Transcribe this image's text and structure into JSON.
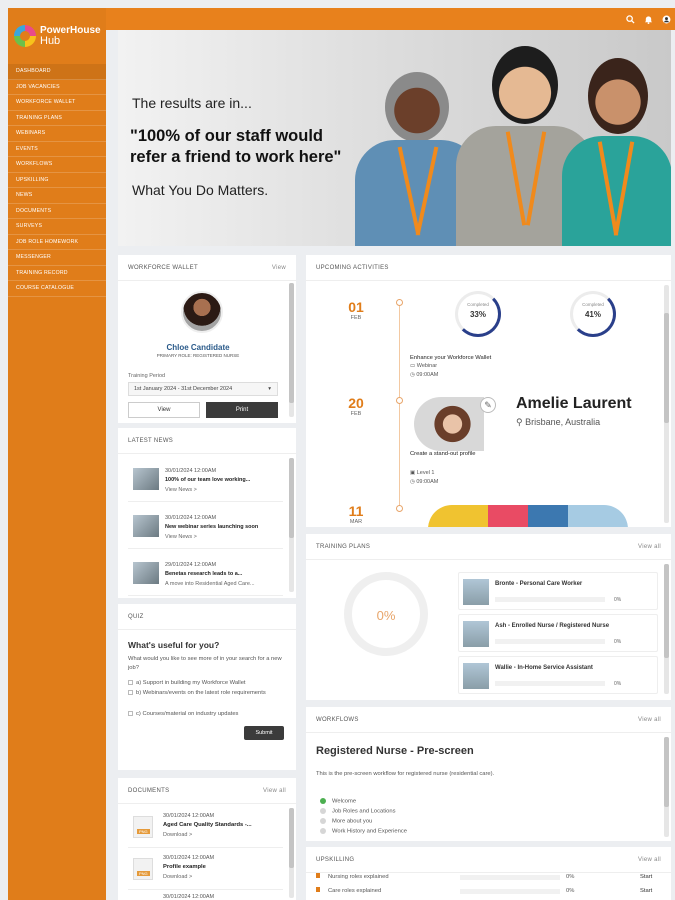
{
  "brand": {
    "name": "PowerHouse",
    "sub": "Hub"
  },
  "nav": [
    "Dashboard",
    "Job Vacancies",
    "Workforce Wallet",
    "Training Plans",
    "Webinars",
    "Events",
    "Workflows",
    "Upskilling",
    "News",
    "Documents",
    "Surveys",
    "Job Role Homework",
    "Messenger",
    "Training Record",
    "Course Catalogue"
  ],
  "topbar": {
    "search_icon": "search-icon",
    "bell_icon": "bell-icon",
    "user_icon": "user-icon"
  },
  "hero": {
    "line1": "The results are in...",
    "line2": "\"100% of our staff would refer a friend to work here\"",
    "line3": "What You Do Matters."
  },
  "wallet": {
    "title": "Workforce Wallet",
    "link": "View",
    "name": "Chloe Candidate",
    "role": "PRIMARY ROLE: REGISTERED NURSE",
    "period_label": "Training Period",
    "period_value": "1st January 2024 - 31st December 2024",
    "view_label": "View",
    "print_label": "Print"
  },
  "news": {
    "title": "Latest News",
    "items": [
      {
        "date": "30/01/2024 12:00AM",
        "title": "100% of our team love working...",
        "link": "View News >"
      },
      {
        "date": "30/01/2024 12:00AM",
        "title": "New webinar series launching soon",
        "link": "View News >"
      },
      {
        "date": "29/01/2024 12:00AM",
        "title": "Benetas research leads to a...",
        "link": "A move into Residential Aged Care..."
      }
    ]
  },
  "quiz": {
    "title": "Quiz",
    "question": "What's useful for you?",
    "description": "What would you like to see more of in your search for a new job?",
    "options": [
      "a) Support in building my Workforce Wallet",
      "b) Webinars/events on the latest role requirements",
      "c) Courses/material on industry updates"
    ],
    "submit": "Submit"
  },
  "documents": {
    "title": "Documents",
    "link": "View all",
    "items": [
      {
        "date": "30/01/2024 12:00AM",
        "title": "Aged Care Quality Standards -...",
        "link": "Download >",
        "badge": "PNG"
      },
      {
        "date": "30/01/2024 12:00AM",
        "title": "Profile example",
        "link": "Download >",
        "badge": "PNG"
      },
      {
        "date": "30/01/2024 12:00AM",
        "title": "",
        "link": "",
        "badge": "PNG"
      }
    ]
  },
  "activities": {
    "title": "Upcoming Activities",
    "items": [
      {
        "day": "01",
        "month": "FEB",
        "title": "Enhance your Workforce Wallet",
        "type": "Webinar",
        "time": "09:00AM",
        "gauges": [
          {
            "label": "Completed",
            "value": "33%"
          },
          {
            "label": "Completed",
            "value": "41%"
          }
        ]
      },
      {
        "day": "20",
        "month": "FEB",
        "title": "Create a stand-out profile",
        "type": "Level 1",
        "time": "09:00AM",
        "profile_name": "Amelie Laurent",
        "profile_location": "Brisbane, Australia"
      },
      {
        "day": "11",
        "month": "MAR"
      }
    ]
  },
  "training": {
    "title": "Training Plans",
    "link": "View all",
    "overall": "0%",
    "items": [
      {
        "name": "Bronte - Personal Care Worker",
        "pct": "0%"
      },
      {
        "name": "Ash - Enrolled Nurse / Registered Nurse",
        "pct": "0%"
      },
      {
        "name": "Wallie - In-Home Service Assistant",
        "pct": "0%"
      }
    ]
  },
  "workflows": {
    "title": "Workflows",
    "link": "View all",
    "heading": "Registered Nurse - Pre-screen",
    "description": "This is the pre-screen workflow for registered nurse (residential care).",
    "steps": [
      {
        "label": "Welcome",
        "done": true
      },
      {
        "label": "Job Roles and Locations",
        "done": false
      },
      {
        "label": "More about you",
        "done": false
      },
      {
        "label": "Work History and Experience",
        "done": false
      }
    ]
  },
  "upskilling": {
    "title": "Upskilling",
    "link": "View all",
    "items": [
      {
        "name": "Nursing roles explained",
        "pct": "0%",
        "action": "Start"
      },
      {
        "name": "Care roles explained",
        "pct": "0%",
        "action": "Start"
      }
    ]
  },
  "colors": {
    "brand_orange": "#e07d1a",
    "gauge_blue": "#2a3f8a",
    "done_green": "#4caf50"
  }
}
